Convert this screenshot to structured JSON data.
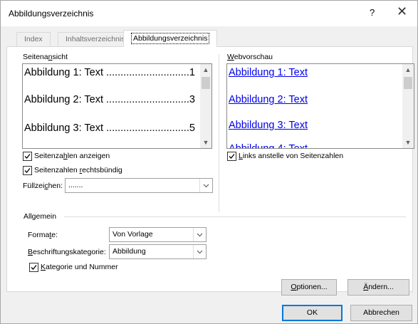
{
  "window": {
    "title": "Abbildungsverzeichnis",
    "help_label": "?",
    "close_label": "✕"
  },
  "tabs": [
    {
      "label": "Index",
      "active": false
    },
    {
      "label": "Inhaltsverzeichnis",
      "active": false
    },
    {
      "label": "Abbildungsverzeichnis",
      "active": true
    }
  ],
  "print_preview": {
    "label": "Seitenansicht",
    "entries": [
      {
        "text": "Abbildung 1: Text",
        "dots": ".............................",
        "page": "1"
      },
      {
        "text": "Abbildung 2: Text",
        "dots": ".............................",
        "page": "3"
      },
      {
        "text": "Abbildung 3: Text",
        "dots": ".............................",
        "page": "5"
      }
    ]
  },
  "web_preview": {
    "label": "Webvorschau",
    "entries": [
      "Abbildung 1: Text",
      "Abbildung 2: Text",
      "Abbildung 3: Text",
      "Abbildung 4: Text"
    ]
  },
  "options": {
    "show_page_numbers": {
      "label": "Seitenzahlen anzeigen",
      "checked": true
    },
    "right_align": {
      "label": "Seitenzahlen rechtsbündig",
      "checked": true
    },
    "tab_leader": {
      "label": "Füllzeichen:",
      "value": "......."
    },
    "use_links": {
      "label": "Links anstelle von Seitenzahlen",
      "checked": true
    }
  },
  "general": {
    "label": "Allgemein",
    "formats": {
      "label": "Formate:",
      "value": "Von Vorlage"
    },
    "caption_label": {
      "label": "Beschriftungskategorie:",
      "value": "Abbildung"
    },
    "include_label": {
      "label": "Kategorie und Nummer",
      "checked": true
    }
  },
  "buttons": {
    "options": "Optionen...",
    "modify": "Ändern...",
    "ok": "OK",
    "cancel": "Abbrechen"
  }
}
